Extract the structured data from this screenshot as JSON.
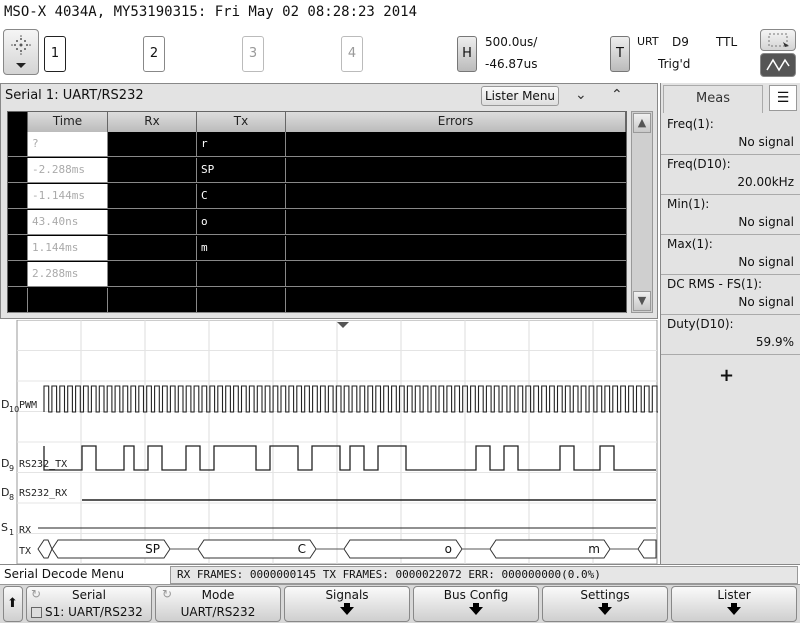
{
  "header": {
    "title": "MSO-X 4034A, MY53190315: Fri May 02 08:28:23 2014"
  },
  "toolbar": {
    "channels": [
      "1",
      "2",
      "3",
      "4"
    ],
    "horizontal": {
      "button": "H",
      "scale": "500.0us/",
      "delay": "-46.87us"
    },
    "trigger": {
      "button": "T",
      "mode": "URT",
      "source": "D9",
      "level": "TTL",
      "status": "Trig'd"
    }
  },
  "lister": {
    "title": "Serial 1: UART/RS232",
    "menu_button": "Lister Menu",
    "columns": [
      "Time",
      "Rx",
      "Tx",
      "Errors"
    ],
    "rows": [
      {
        "time": "?",
        "rx": "",
        "tx": "r",
        "errors": ""
      },
      {
        "time": "-2.288ms",
        "rx": "",
        "tx": "SP",
        "errors": ""
      },
      {
        "time": "-1.144ms",
        "rx": "",
        "tx": "C",
        "errors": ""
      },
      {
        "time": "43.40ns",
        "rx": "",
        "tx": "o",
        "errors": ""
      },
      {
        "time": "1.144ms",
        "rx": "",
        "tx": "m",
        "errors": ""
      },
      {
        "time": "2.288ms",
        "rx": "",
        "tx": "",
        "errors": ""
      }
    ]
  },
  "waveform": {
    "channels": [
      {
        "label": "D10",
        "name": "PWM"
      },
      {
        "label": "D9",
        "name": "RS232_TX"
      },
      {
        "label": "D8",
        "name": "RS232_RX"
      },
      {
        "label": "S1",
        "rx": "RX",
        "tx": "TX"
      }
    ],
    "decoded_tx": [
      "SP",
      "C",
      "o",
      "m"
    ]
  },
  "meas": {
    "tab": "Meas",
    "items": [
      {
        "name": "Freq(1):",
        "value": "No signal"
      },
      {
        "name": "Freq(D10):",
        "value": "20.00kHz"
      },
      {
        "name": "Min(1):",
        "value": "No signal"
      },
      {
        "name": "Max(1):",
        "value": "No signal"
      },
      {
        "name": "DC RMS - FS(1):",
        "value": "No signal"
      },
      {
        "name": "Duty(D10):",
        "value": "59.9%"
      }
    ],
    "add": "+"
  },
  "status": {
    "menu_title": "Serial Decode Menu",
    "frames": "RX FRAMES: 0000000145  TX FRAMES: 0000022072  ERR: 000000000(0.0%)"
  },
  "softkeys": {
    "serial": {
      "label": "Serial",
      "value": "S1: UART/RS232"
    },
    "mode": {
      "label": "Mode",
      "value": "UART/RS232"
    },
    "signals": "Signals",
    "bus_config": "Bus Config",
    "settings": "Settings",
    "lister": "Lister"
  }
}
